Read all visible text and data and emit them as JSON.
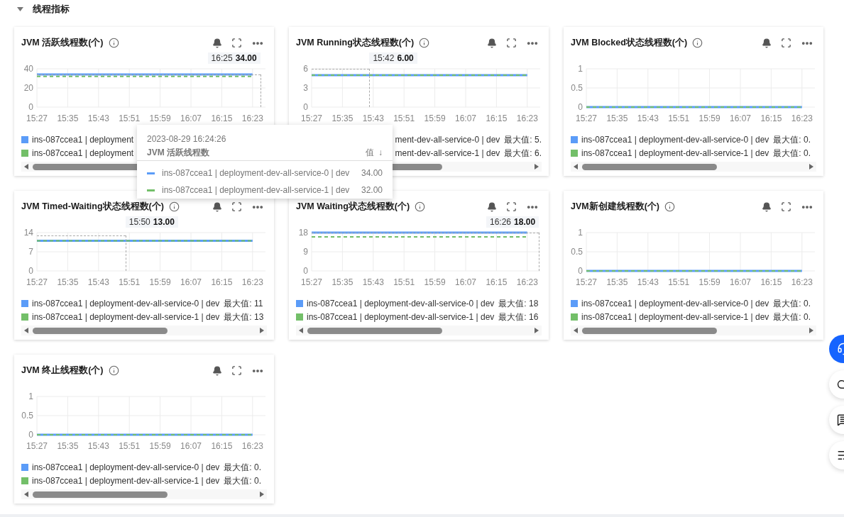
{
  "section": {
    "title": "线程指标",
    "expanded": true
  },
  "cards": [
    {
      "title": "JVM 活跃线程数(个)",
      "pointer": {
        "time": "16:25",
        "value": "34.00"
      },
      "chart_data": {
        "type": "line",
        "grid": true,
        "categories": [
          "15:27",
          "15:35",
          "15:43",
          "15:51",
          "15:59",
          "16:07",
          "16:15",
          "16:23"
        ],
        "yticks": [
          0,
          20,
          40
        ],
        "ylim": [
          0,
          40
        ],
        "series": [
          {
            "name": "ins-087ccea1 | deployment",
            "color": "#5b9cf8",
            "line_style": "solid",
            "values": [
              34,
              34,
              34,
              34,
              34,
              34,
              34,
              34
            ]
          },
          {
            "name": "ins-087ccea1 | deployment",
            "color": "#73bf69",
            "line_style": "dashed",
            "values": [
              32,
              32,
              32,
              32,
              32,
              32,
              32,
              32
            ]
          }
        ]
      },
      "legend": [
        {
          "swatch": true
        },
        {
          "swatch": true
        }
      ],
      "scrollbar": {
        "left_arrow": true,
        "right_arrow": false
      }
    },
    {
      "title": "JVM Running状态线程数(个)",
      "pointer": {
        "time": "15:42",
        "value": "6.00"
      },
      "chart_data": {
        "type": "line",
        "grid": true,
        "categories": [
          "15:27",
          "15:35",
          "15:43",
          "15:51",
          "15:59",
          "16:07",
          "16:15",
          "16:23"
        ],
        "yticks": [
          0,
          3,
          6
        ],
        "ylim": [
          0,
          6
        ],
        "series": [
          {
            "name": "ment-dev-all-service-0 | dev",
            "color": "#5b9cf8",
            "line_style": "solid",
            "values": [
              5,
              5,
              5,
              5,
              5,
              5,
              5,
              5
            ]
          },
          {
            "name": "ment-dev-all-service-1 | dev",
            "color": "#73bf69",
            "line_style": "dashed",
            "values": [
              5,
              5,
              5,
              5,
              5,
              5,
              5,
              5
            ]
          }
        ]
      },
      "legend": [
        {
          "max": "最大值: 5.",
          "swatch": false
        },
        {
          "max": "最大值: 6.",
          "swatch": false
        }
      ],
      "scrollbar": {
        "left_arrow": false,
        "right_arrow": true
      }
    },
    {
      "title": "JVM Blocked状态线程数(个)",
      "chart_data": {
        "type": "line",
        "grid": true,
        "categories": [
          "15:27",
          "15:35",
          "15:43",
          "15:51",
          "15:59",
          "16:07",
          "16:15",
          "16:23"
        ],
        "yticks": [
          0,
          0.5,
          1
        ],
        "ylim": [
          0,
          1
        ],
        "series": [
          {
            "name": "ins-087ccea1 | deployment-dev-all-service-0 | dev",
            "color": "#5b9cf8",
            "line_style": "solid",
            "values": [
              0,
              0,
              0,
              0,
              0,
              0,
              0,
              0
            ]
          },
          {
            "name": "ins-087ccea1 | deployment-dev-all-service-1 | dev",
            "color": "#73bf69",
            "line_style": "dashed",
            "values": [
              0,
              0,
              0,
              0,
              0,
              0,
              0,
              0
            ]
          }
        ]
      },
      "legend": [
        {
          "max": "最大值: 0.",
          "swatch": true
        },
        {
          "max": "最大值: 0.",
          "swatch": true
        }
      ]
    },
    {
      "title": "JVM Timed-Waiting状态线程数(个)",
      "pointer": {
        "time": "15:50",
        "value": "13.00"
      },
      "chart_data": {
        "type": "line",
        "grid": true,
        "categories": [
          "15:27",
          "15:35",
          "15:43",
          "15:51",
          "15:59",
          "16:07",
          "16:15",
          "16:23"
        ],
        "yticks": [
          0,
          7,
          14
        ],
        "ylim": [
          0,
          14
        ],
        "series": [
          {
            "name": "ins-087ccea1 | deployment-dev-all-service-0 | dev",
            "color": "#5b9cf8",
            "line_style": "solid",
            "values": [
              11,
              11,
              11,
              11,
              11,
              11,
              11,
              11
            ]
          },
          {
            "name": "ins-087ccea1 | deployment-dev-all-service-1 | dev",
            "color": "#73bf69",
            "line_style": "dashed",
            "values": [
              11,
              11,
              11,
              11,
              11,
              11,
              11,
              11
            ]
          }
        ]
      },
      "legend": [
        {
          "max": "最大值: 11",
          "swatch": true
        },
        {
          "max": "最大值: 13",
          "swatch": true
        }
      ]
    },
    {
      "title": "JVM Waiting状态线程数(个)",
      "pointer": {
        "time": "16:26",
        "value": "18.00"
      },
      "chart_data": {
        "type": "line",
        "grid": true,
        "categories": [
          "15:27",
          "15:35",
          "15:43",
          "15:51",
          "15:59",
          "16:07",
          "16:15",
          "16:23"
        ],
        "yticks": [
          0,
          9,
          18
        ],
        "ylim": [
          0,
          18
        ],
        "series": [
          {
            "name": "ins-087ccea1 | deployment-dev-all-service-0 | dev",
            "color": "#5b9cf8",
            "line_style": "solid",
            "values": [
              18,
              18,
              18,
              18,
              18,
              18,
              18,
              18
            ]
          },
          {
            "name": "ins-087ccea1 | deployment-dev-all-service-1 | dev",
            "color": "#73bf69",
            "line_style": "dashed",
            "values": [
              16,
              16,
              16,
              16,
              16,
              16,
              16,
              16
            ]
          }
        ]
      },
      "legend": [
        {
          "max": "最大值: 18",
          "swatch": true
        },
        {
          "max": "最大值: 16",
          "swatch": true
        }
      ]
    },
    {
      "title": "JVM新创建线程数(个)",
      "chart_data": {
        "type": "line",
        "grid": true,
        "categories": [
          "15:27",
          "15:35",
          "15:43",
          "15:51",
          "15:59",
          "16:07",
          "16:15",
          "16:23"
        ],
        "yticks": [
          0,
          0.5,
          1
        ],
        "ylim": [
          0,
          1
        ],
        "series": [
          {
            "name": "ins-087ccea1 | deployment-dev-all-service-0 | dev",
            "color": "#5b9cf8",
            "line_style": "solid",
            "values": [
              0,
              0,
              0,
              0,
              0,
              0,
              0,
              0
            ]
          },
          {
            "name": "ins-087ccea1 | deployment-dev-all-service-1 | dev",
            "color": "#73bf69",
            "line_style": "dashed",
            "values": [
              0,
              0,
              0,
              0,
              0,
              0,
              0,
              0
            ]
          }
        ]
      },
      "legend": [
        {
          "max": "最大值: 0.",
          "swatch": true
        },
        {
          "max": "最大值: 0.",
          "swatch": true
        }
      ]
    },
    {
      "title": "JVM 终止线程数(个)",
      "chart_data": {
        "type": "line",
        "grid": true,
        "categories": [
          "15:27",
          "15:35",
          "15:43",
          "15:51",
          "15:59",
          "16:07",
          "16:15",
          "16:23"
        ],
        "yticks": [
          0,
          0.5,
          1
        ],
        "ylim": [
          0,
          1
        ],
        "series": [
          {
            "name": "ins-087ccea1 | deployment-dev-all-service-0 | dev",
            "color": "#5b9cf8",
            "line_style": "solid",
            "values": [
              0,
              0,
              0,
              0,
              0,
              0,
              0,
              0
            ]
          },
          {
            "name": "ins-087ccea1 | deployment-dev-all-service-1 | dev",
            "color": "#73bf69",
            "line_style": "dashed",
            "values": [
              0,
              0,
              0,
              0,
              0,
              0,
              0,
              0
            ]
          }
        ]
      },
      "legend": [
        {
          "max": "最大值: 0.",
          "swatch": true
        },
        {
          "max": "最大值: 0.",
          "swatch": true
        }
      ]
    }
  ],
  "tooltip": {
    "datetime": "2023-08-29 16:24:26",
    "title": "JVM 活跃线程数",
    "value_header": "值",
    "sort": "↓",
    "rows": [
      {
        "name": "ins-087ccea1 | deployment-dev-all-service-0 | dev",
        "value": "34.00",
        "color": "#5b9cf8"
      },
      {
        "name": "ins-087ccea1 | deployment-dev-all-service-1 | dev",
        "value": "32.00",
        "color": "#73bf69"
      }
    ]
  }
}
